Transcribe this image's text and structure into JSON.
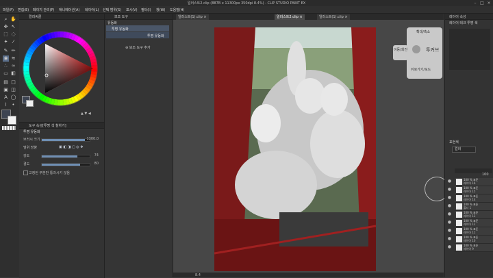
{
  "window": {
    "title": "일러스트2.clip (887B x 11300px 350dpi 8.4%) - CLIP STUDIO PAINT EX"
  },
  "menu": [
    "파일(F)",
    "편집(E)",
    "페이지 관리(P)",
    "애니메이션(A)",
    "레이어(L)",
    "선택 범위(S)",
    "표시(V)",
    "필터(I)",
    "창(W)",
    "도움말(H)"
  ],
  "color_panel": {
    "title": "컬러써클",
    "accent_hue": "#ff1010"
  },
  "tool_property": {
    "tab_title": "도구 속성[투명 색 칠하기]",
    "tool_name": "투명 유동화",
    "rows": [
      {
        "label": "브러시 크기",
        "value": "1300.0",
        "fill": 0.9
      },
      {
        "label": "범위 방향",
        "value": "",
        "fill": 0.0
      },
      {
        "label": "강도",
        "value": "74",
        "fill": 0.74
      },
      {
        "label": "경도",
        "value": "80",
        "fill": 0.8
      }
    ],
    "checkbox_label": "고정된 부분만 통과시키 않음"
  },
  "sub_tool": {
    "header": "보조 도구",
    "group": "유동화",
    "items": [
      "투명 유동화",
      "투명 유동화"
    ],
    "add_label": "보조 도구 추가"
  },
  "canvas": {
    "tabs": [
      "일러스트2.clip",
      "일러스트(1).clip"
    ],
    "zoom": "8.4"
  },
  "navigator": {
    "top_label": "확대/축소",
    "left_label": "이동/회전",
    "center_label": "투커브",
    "bottom_label": "뒤로가기/모드"
  },
  "layer_panel": {
    "header": "레이어 속성",
    "sub_header": "레이어 테크 투명 색",
    "blend_label": "표현색",
    "blend_value": "컬러",
    "opacity_label": "100",
    "layers": [
      {
        "pct": "100 % 표준",
        "name": "레이어 16"
      },
      {
        "pct": "100 % 표준",
        "name": "레이어 15"
      },
      {
        "pct": "100 % 표준",
        "name": "레이어 14"
      },
      {
        "pct": "100 % 표준",
        "name": "폴더 1"
      },
      {
        "pct": "100 % 표준",
        "name": "레이어 13"
      },
      {
        "pct": "100 % 표준",
        "name": "레이어 12"
      },
      {
        "pct": "100 % 표준",
        "name": "레이어 11"
      },
      {
        "pct": "100 % 표준",
        "name": "레이어 10"
      },
      {
        "pct": "100 % 표준",
        "name": "레이어 9"
      }
    ]
  }
}
